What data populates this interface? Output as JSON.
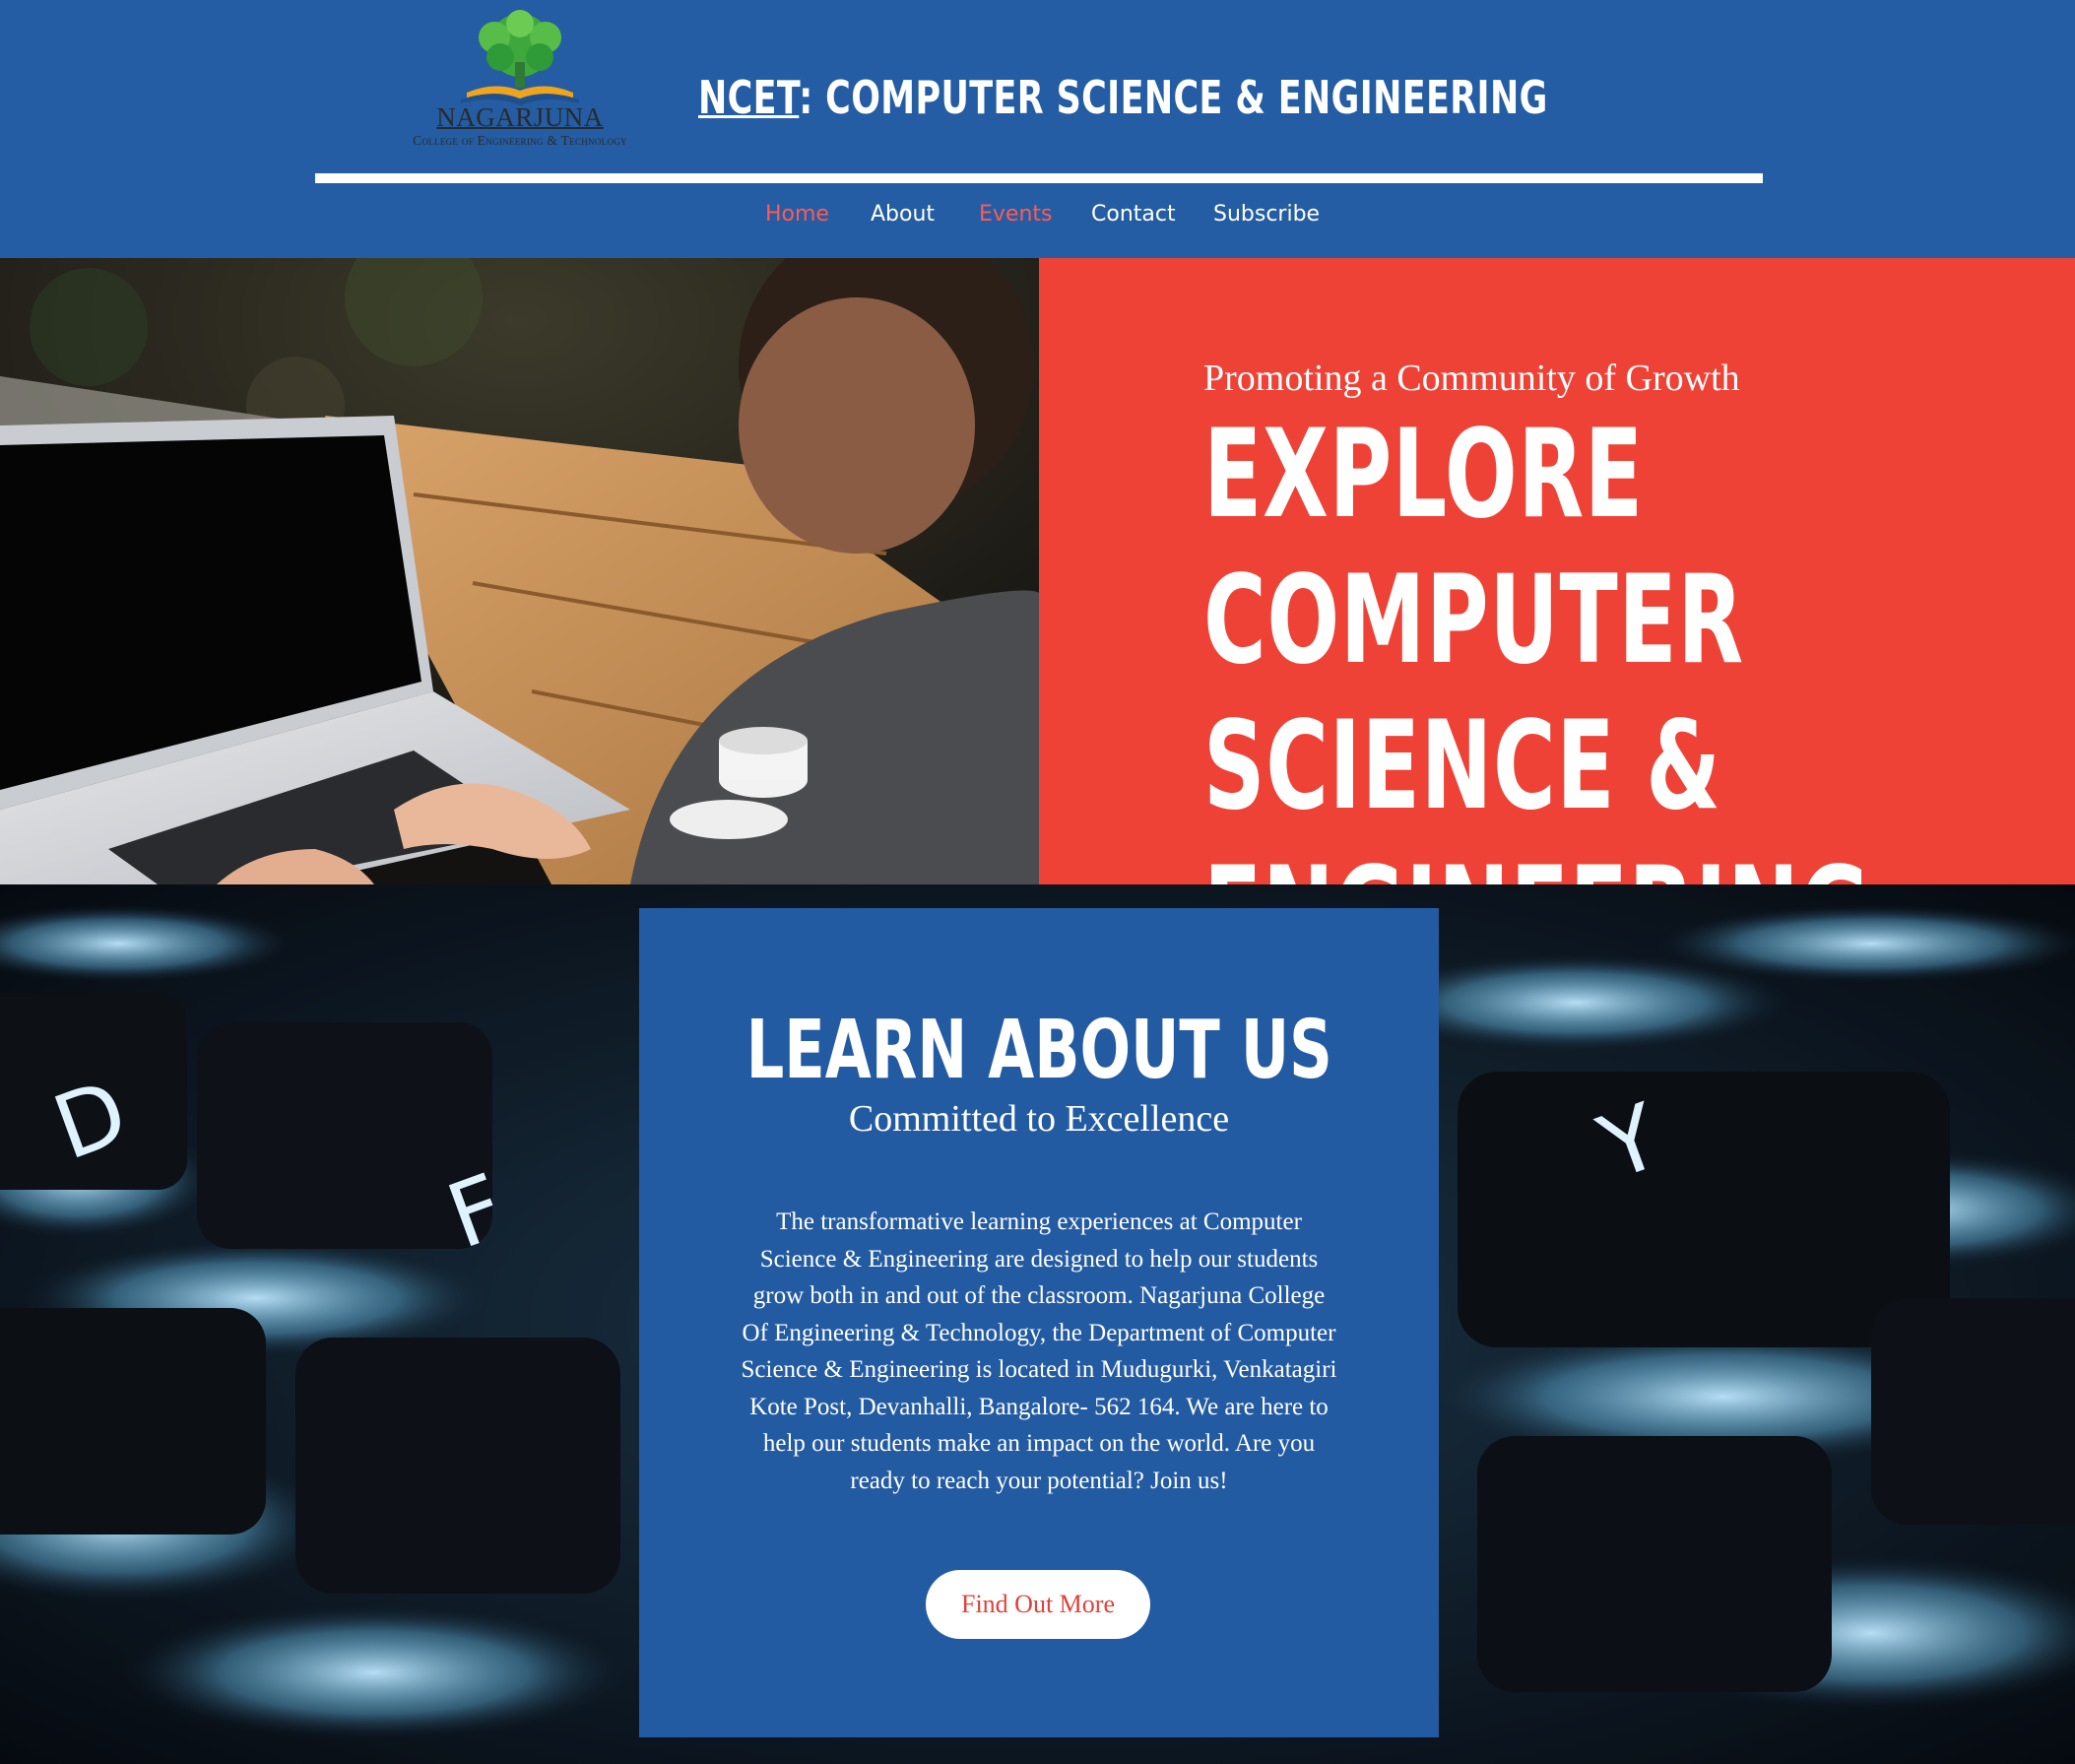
{
  "header": {
    "logo": {
      "icon": "tree-book-emblem-icon",
      "name": "NAGARJUNA",
      "subtitle": "College of Engineering & Technology"
    },
    "title_brand": "NCET",
    "title_rest": ": COMPUTER SCIENCE & ENGINEERING"
  },
  "nav": {
    "items": [
      {
        "label": "Home",
        "active": true
      },
      {
        "label": "About",
        "active": false
      },
      {
        "label": "Events",
        "active": true
      },
      {
        "label": "Contact",
        "active": false
      },
      {
        "label": "Subscribe",
        "active": false
      }
    ]
  },
  "hero": {
    "tagline": "Promoting a Community of Growth",
    "heading": "EXPLORE\nCOMPUTER\nSCIENCE &\nENGINEERING",
    "image": "person-typing-on-laptop-photo"
  },
  "about": {
    "background_image": "backlit-keyboard-photo",
    "heading": "LEARN ABOUT US",
    "subheading": "Committed to Excellence",
    "body": "The transformative learning experiences at Computer Science & Engineering are designed to help our students grow both in and out of the classroom. Nagarjuna College Of Engineering & Technology, the Department of Computer Science & Engineering is located in Mudugurki, Venkatagiri Kote Post, Devanhalli, Bangalore- 562 164. We are here to help our students make an impact on the world. Are you ready to reach your potential? Join us!",
    "button_label": "Find Out More"
  },
  "colors": {
    "header_blue": "#245da3",
    "hero_red": "#ee4236",
    "card_blue": "#235ba2",
    "nav_active": "#ff5a55",
    "button_text": "#e0413a"
  }
}
